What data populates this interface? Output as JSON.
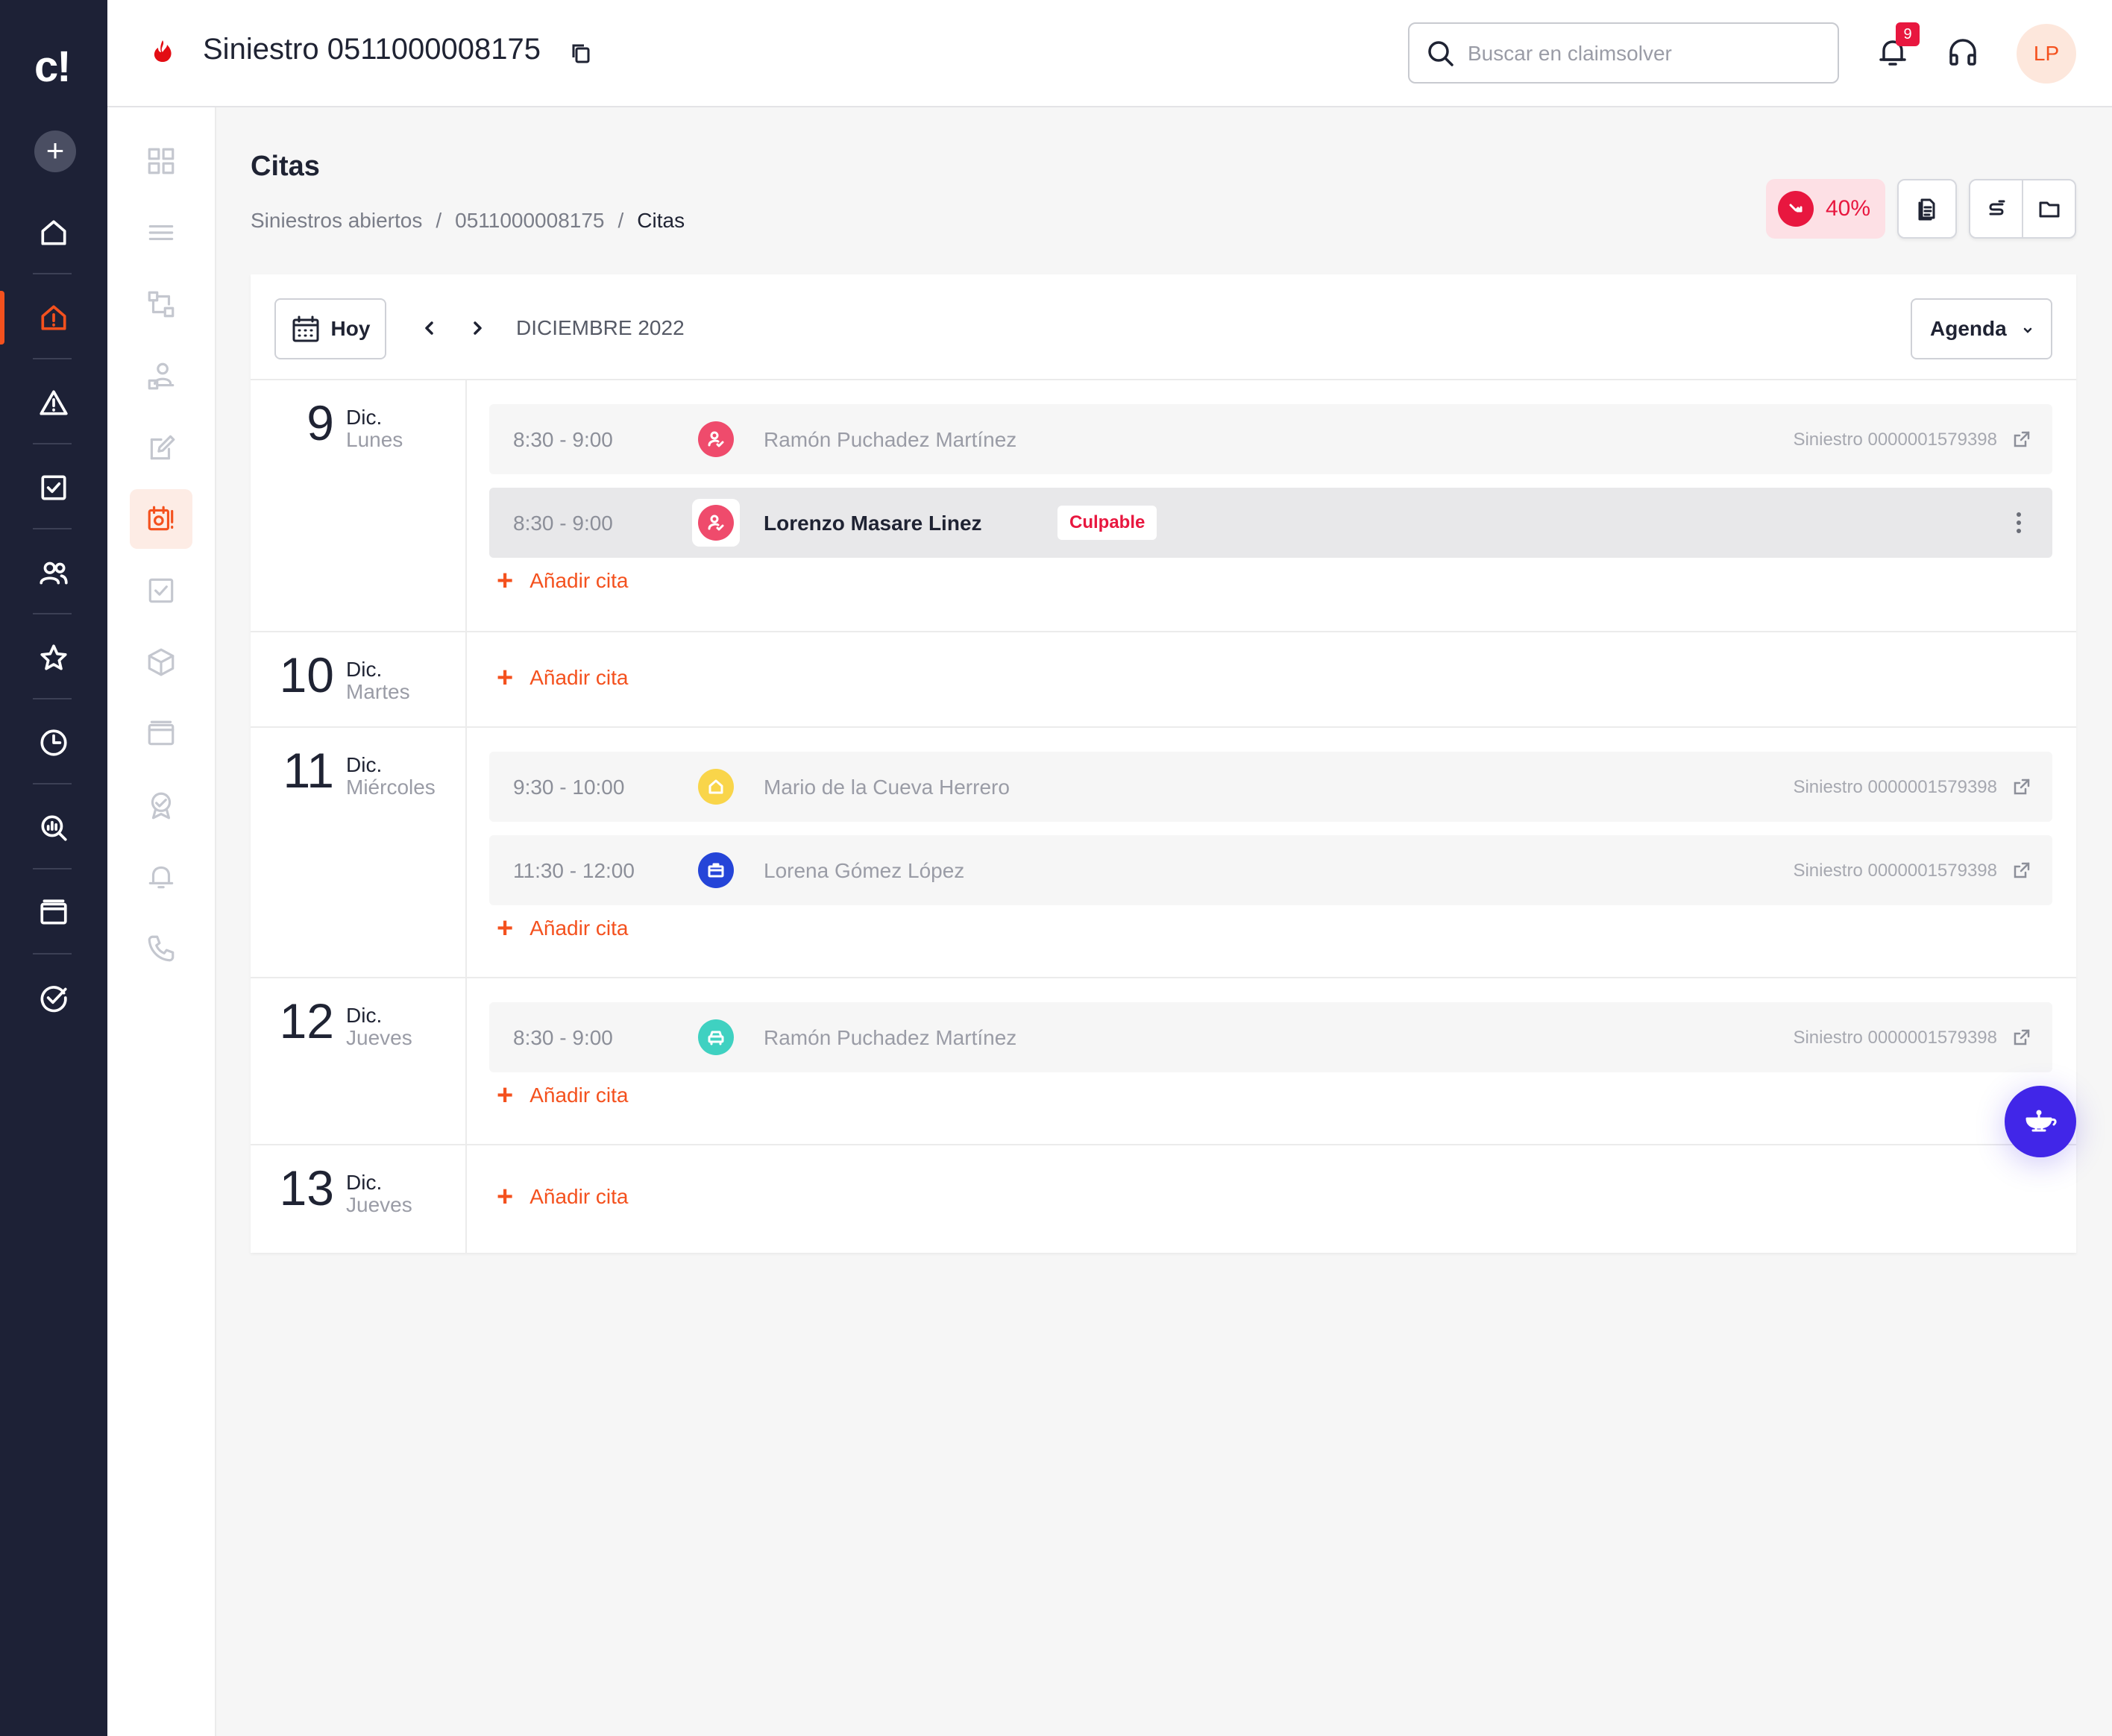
{
  "nav": {
    "logo": "c!",
    "add_label": "+",
    "items": [
      {
        "icon": "home-icon"
      },
      {
        "icon": "claim-alert-icon",
        "active": true
      },
      {
        "icon": "warning-icon"
      },
      {
        "icon": "task-check-icon"
      },
      {
        "icon": "users-icon"
      },
      {
        "icon": "star-icon"
      },
      {
        "icon": "clock-icon"
      },
      {
        "icon": "analytics-search-icon"
      },
      {
        "icon": "window-icon"
      },
      {
        "icon": "check-circle-icon"
      }
    ]
  },
  "sidebar": {
    "items": [
      {
        "icon": "dashboard-grid-icon"
      },
      {
        "icon": "list-icon"
      },
      {
        "icon": "flow-icon"
      },
      {
        "icon": "person-desk-icon"
      },
      {
        "icon": "edit-doc-icon"
      },
      {
        "icon": "calendar-alert-icon",
        "active": true
      },
      {
        "icon": "checkbox-icon"
      },
      {
        "icon": "package-icon"
      },
      {
        "icon": "browser-window-icon"
      },
      {
        "icon": "award-icon"
      },
      {
        "icon": "bell-icon"
      },
      {
        "icon": "phone-icon"
      }
    ]
  },
  "header": {
    "claim_title": "Siniestro 0511000008175",
    "search_placeholder": "Buscar en claimsolver",
    "notifications_count": "9",
    "avatar_initials": "LP"
  },
  "page": {
    "title": "Citas",
    "breadcrumb": {
      "item1": "Siniestros abiertos",
      "sep": "/",
      "item2": "0511000008175",
      "current": "Citas"
    },
    "score_label": "40%"
  },
  "calendar": {
    "today_label": "Hoy",
    "month_label": "DICIEMBRE 2022",
    "view_label": "Agenda",
    "add_label": "Añadir cita",
    "days": [
      {
        "num": "9",
        "month": "Dic.",
        "weekday": "Lunes",
        "appointments": [
          {
            "time": "8:30 - 9:00",
            "icon": "person-check-icon",
            "color": "#ef4b6c",
            "name": "Ramón Puchadez Martínez",
            "claim": "Siniestro 0000001579398"
          },
          {
            "time": "8:30 - 9:00",
            "icon": "person-check-icon",
            "color": "#ef4b6c",
            "name": "Lorenzo Masare Linez",
            "tag": "Culpable"
          }
        ]
      },
      {
        "num": "10",
        "month": "Dic.",
        "weekday": "Martes",
        "appointments": []
      },
      {
        "num": "11",
        "month": "Dic.",
        "weekday": "Miércoles",
        "appointments": [
          {
            "time": "9:30 - 10:00",
            "icon": "house-icon",
            "color": "#f9d54a",
            "name": "Mario de la Cueva Herrero",
            "claim": "Siniestro 0000001579398"
          },
          {
            "time": "11:30 - 12:00",
            "icon": "briefcase-icon",
            "color": "#2545d8",
            "name": "Lorena Gómez López",
            "claim": "Siniestro 0000001579398"
          }
        ]
      },
      {
        "num": "12",
        "month": "Dic.",
        "weekday": "Jueves",
        "appointments": [
          {
            "time": "8:30 - 9:00",
            "icon": "car-icon",
            "color": "#3fd1c1",
            "name": "Ramón Puchadez Martínez",
            "claim": "Siniestro 0000001579398"
          }
        ]
      },
      {
        "num": "13",
        "month": "Dic.",
        "weekday": "Jueves",
        "appointments": []
      }
    ]
  },
  "colors": {
    "accent": "#f4511e",
    "nav_bg": "#1d2136",
    "alert": "#e8173f",
    "fab": "#4126e8"
  }
}
